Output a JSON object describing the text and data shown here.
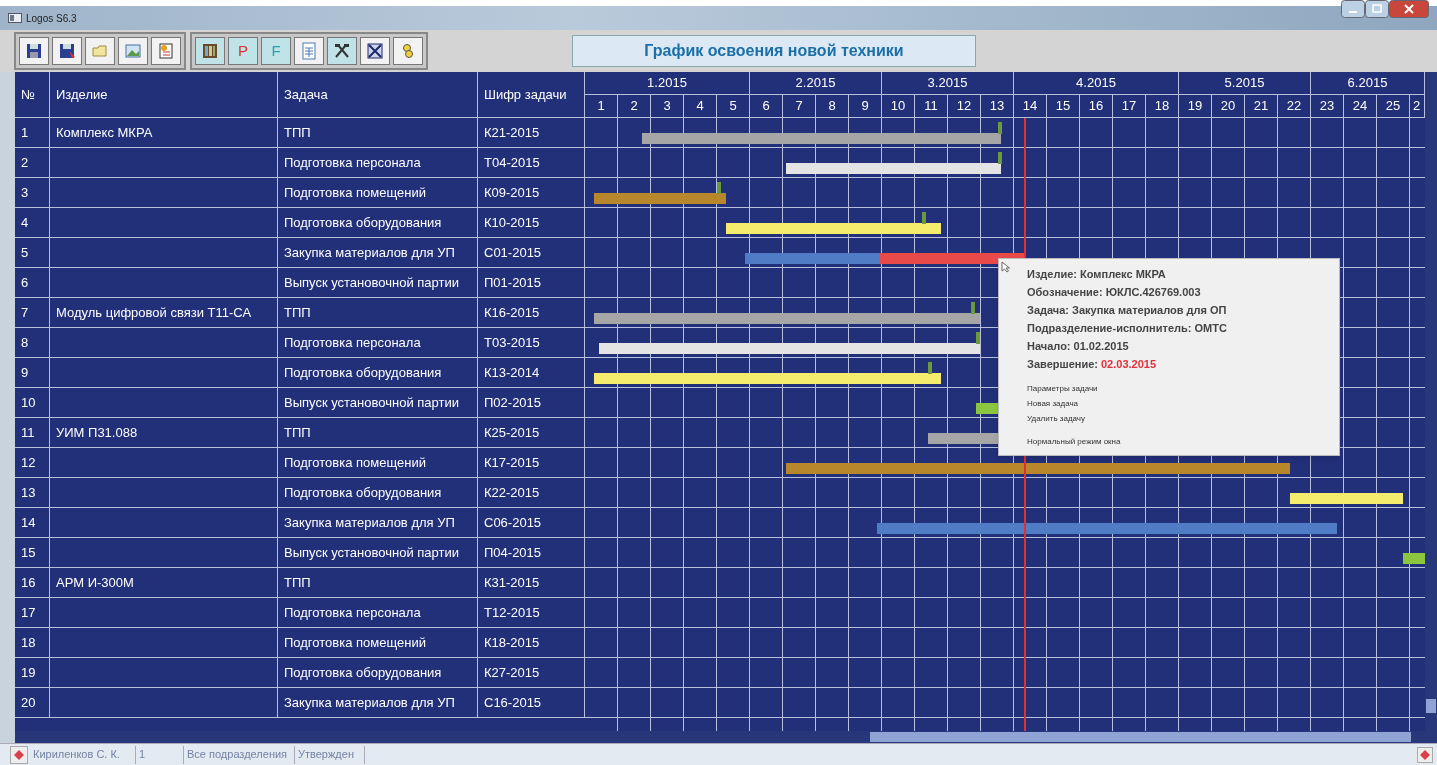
{
  "window": {
    "title": "Logos S6.3"
  },
  "toolbar": {
    "groups": [
      [
        {
          "kind": "save",
          "pressed": false
        },
        {
          "kind": "save-as",
          "pressed": false
        },
        {
          "kind": "folder",
          "pressed": false
        },
        {
          "kind": "picture",
          "pressed": false
        },
        {
          "kind": "note",
          "pressed": false
        }
      ],
      [
        {
          "kind": "columns",
          "pressed": true
        },
        {
          "kind": "letter",
          "label": "P",
          "pressed": true
        },
        {
          "kind": "letter",
          "label": "F",
          "pressed": true
        },
        {
          "kind": "document",
          "pressed": false
        },
        {
          "kind": "tools",
          "pressed": true
        },
        {
          "kind": "cross",
          "pressed": false
        },
        {
          "kind": "figure",
          "pressed": false
        }
      ]
    ]
  },
  "title_field": {
    "value": "График освоения новой техники"
  },
  "table": {
    "columns": [
      "№",
      "Изделие",
      "Задача",
      "Шифр задачи"
    ],
    "months": [
      {
        "label": "1.2015",
        "weeks": [
          "1",
          "2",
          "3",
          "4",
          "5"
        ]
      },
      {
        "label": "2.2015",
        "weeks": [
          "6",
          "7",
          "8",
          "9"
        ]
      },
      {
        "label": "3.2015",
        "weeks": [
          "10",
          "11",
          "12",
          "13"
        ]
      },
      {
        "label": "4.2015",
        "weeks": [
          "14",
          "15",
          "16",
          "17",
          "18"
        ]
      },
      {
        "label": "5.2015",
        "weeks": [
          "19",
          "20",
          "21",
          "22"
        ]
      },
      {
        "label": "6.2015",
        "weeks": [
          "23",
          "24",
          "25",
          "2"
        ]
      }
    ],
    "rows": [
      {
        "number": "1",
        "product": "Комплекс МКРА",
        "task": "ТПП",
        "code": "К21-2015",
        "bars": [
          {
            "color": "#a6a6a6"
          }
        ],
        "milestone": true
      },
      {
        "number": "2",
        "task": "Подготовка персонала",
        "code": "Т04-2015",
        "bars": [
          {
            "color": "#e4e4e4"
          }
        ],
        "milestone": true
      },
      {
        "number": "3",
        "task": "Подготовка помещений",
        "code": "К09-2015",
        "bars": [
          {
            "color": "#b8862b"
          }
        ],
        "milestone": true
      },
      {
        "number": "4",
        "task": "Подготовка оборудования",
        "code": "К10-2015",
        "bars": [
          {
            "color": "#f5ec6e"
          }
        ],
        "milestone": true
      },
      {
        "number": "5",
        "task": "Закупка материалов для УП",
        "code": "С01-2015",
        "bars": [
          {
            "color": "#4f7cc4"
          },
          {
            "color": "#e84a4a"
          }
        ]
      },
      {
        "number": "6",
        "task": "Выпуск установочной партии",
        "code": "П01-2015"
      },
      {
        "number": "7",
        "product": "Модуль цифровой связи Т11-СА",
        "task": "ТПП",
        "code": "К16-2015",
        "bars": [
          {
            "color": "#a6a6a6"
          }
        ],
        "milestone": true
      },
      {
        "number": "8",
        "task": "Подготовка персонала",
        "code": "Т03-2015",
        "bars": [
          {
            "color": "#e4e4e4"
          }
        ],
        "milestone": true
      },
      {
        "number": "9",
        "task": "Подготовка оборудования",
        "code": "К13-2014",
        "bars": [
          {
            "color": "#f5ec6e"
          }
        ],
        "milestone": true
      },
      {
        "number": "10",
        "task": "Выпуск установочной партии",
        "code": "П02-2015",
        "bars": [
          {
            "color": "#8cc63f"
          }
        ]
      },
      {
        "number": "11",
        "product": "УИМ П31.088",
        "task": "ТПП",
        "code": "К25-2015",
        "bars": [
          {
            "color": "#a6a6a6"
          }
        ]
      },
      {
        "number": "12",
        "task": "Подготовка помещений",
        "code": "К17-2015",
        "bars": [
          {
            "color": "#b8862b"
          }
        ]
      },
      {
        "number": "13",
        "task": "Подготовка оборудования",
        "code": "К22-2015",
        "bars": [
          {
            "color": "#f5ec6e"
          }
        ]
      },
      {
        "number": "14",
        "task": "Закупка материалов для УП",
        "code": "С06-2015",
        "bars": [
          {
            "color": "#4f7cc4"
          }
        ]
      },
      {
        "number": "15",
        "task": "Выпуск установочной партии",
        "code": "П04-2015",
        "bars": [
          {
            "color": "#8cc63f"
          }
        ]
      },
      {
        "number": "16",
        "product": "АРМ И-300М",
        "task": "ТПП",
        "code": "К31-2015"
      },
      {
        "number": "17",
        "task": "Подготовка персонала",
        "code": "Т12-2015"
      },
      {
        "number": "18",
        "task": "Подготовка помещений",
        "code": "К18-2015"
      },
      {
        "number": "19",
        "task": "Подготовка оборудования",
        "code": "К27-2015"
      },
      {
        "number": "20",
        "task": "Закупка материалов для УП",
        "code": "С16-2015"
      }
    ]
  },
  "tooltip": {
    "lines": [
      {
        "label": "Изделие:",
        "value": "Комплекс МКРА",
        "highlight": false
      },
      {
        "label": "Обозначение:",
        "value": "ЮКЛС.426769.003",
        "highlight": false
      },
      {
        "label": "Задача:",
        "value": "Закупка материалов для ОП",
        "highlight": false
      },
      {
        "label": "Подразделение-исполнитель:",
        "value": "ОМТС",
        "highlight": false
      },
      {
        "label": "Начало:",
        "value": "01.02.2015",
        "highlight": false
      },
      {
        "label": "Завершение:",
        "value": "02.03.2015",
        "highlight": true
      }
    ],
    "menu": [
      [
        "Параметры задачи",
        "Новая задача",
        "Удалить задачу"
      ],
      [
        "Нормальный режим окна"
      ]
    ]
  },
  "status_bar": {
    "cells": [
      "Кириленков С. К.",
      "1",
      "Все подразделения",
      "Утвержден"
    ]
  }
}
